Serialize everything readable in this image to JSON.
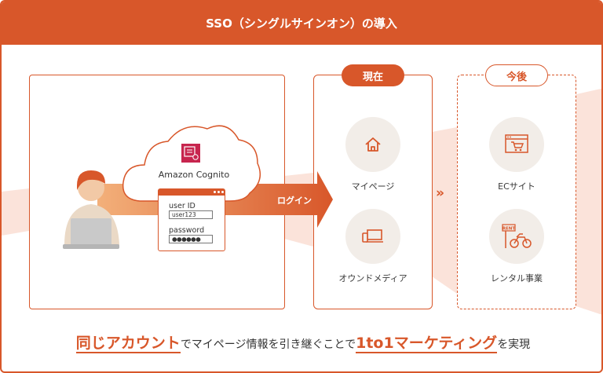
{
  "header": {
    "title": "SSO（シングルサインオン）の導入"
  },
  "colors": {
    "accent": "#d8572a",
    "band": "#fbe3da",
    "icon_bg": "#f2ede8"
  },
  "cognito": {
    "label": "Amazon Cognito",
    "icon": "cognito-icon"
  },
  "login_form": {
    "user_label": "user ID",
    "user_value": "user123",
    "password_label": "password",
    "password_value": "●●●●●●"
  },
  "arrow_label": "ログイン",
  "current": {
    "label": "現在",
    "items": [
      {
        "label": "マイページ",
        "icon": "house-icon"
      },
      {
        "label": "オウンドメディア",
        "icon": "devices-icon"
      }
    ]
  },
  "future": {
    "label": "今後",
    "items": [
      {
        "label": "ECサイト",
        "icon": "cart-icon"
      },
      {
        "label": "レンタル事業",
        "icon": "rent-bike-icon",
        "sign": "RENT"
      }
    ]
  },
  "transition_icon": "double-chevron-right-icon",
  "bottom": {
    "em1": "同じアカウント",
    "middle": "でマイページ情報を引き継ぐことで",
    "em2": "1to1マーケティング",
    "end": "を実現"
  }
}
